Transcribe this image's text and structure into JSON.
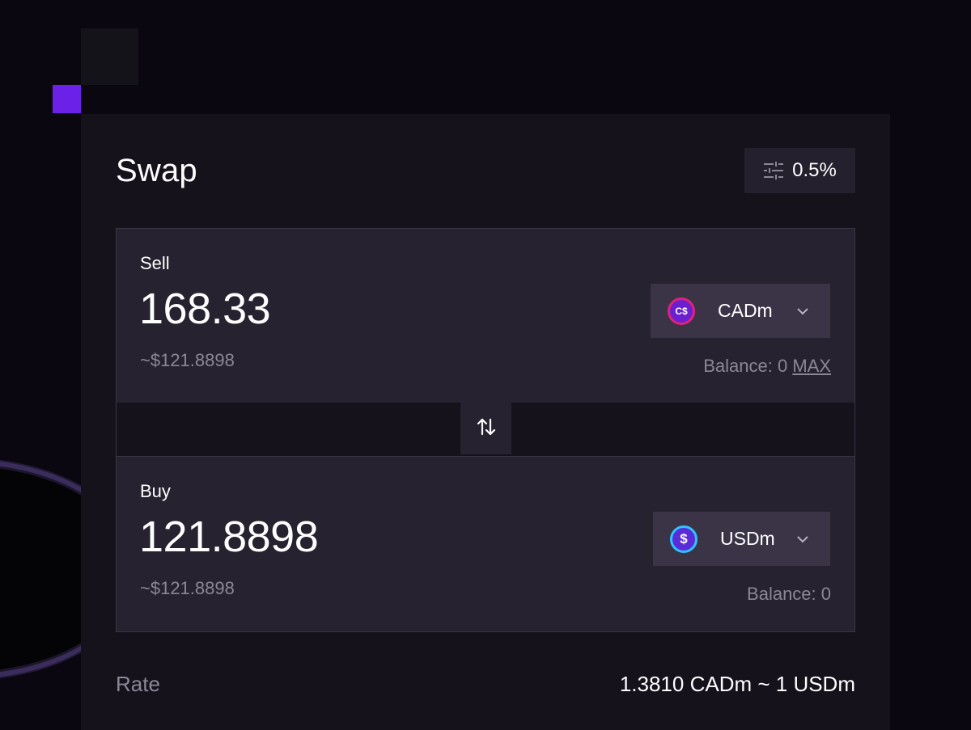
{
  "header": {
    "title": "Swap",
    "slippage": "0.5%",
    "slippage_icon": "sliders-icon"
  },
  "sell": {
    "label": "Sell",
    "amount": "168.33",
    "usd_value": "~$121.8898",
    "token": {
      "symbol": "CADm",
      "icon_text": "C$",
      "icon": "cad-token-icon"
    },
    "balance": "Balance: 0",
    "max_label": "MAX"
  },
  "flip": {
    "icon": "swap-direction-icon"
  },
  "buy": {
    "label": "Buy",
    "amount": "121.8898",
    "usd_value": "~$121.8898",
    "token": {
      "symbol": "USDm",
      "icon_text": "$",
      "icon": "usd-token-icon"
    },
    "balance": "Balance: 0"
  },
  "rate": {
    "label": "Rate",
    "value": "1.3810 CADm ~ 1 USDm"
  },
  "colors": {
    "background": "#0b0710",
    "card": "#15121c",
    "panel": "#26222f",
    "token_select": "#3a3446",
    "accent": "#6b21e8",
    "muted_text": "#8b8797"
  }
}
